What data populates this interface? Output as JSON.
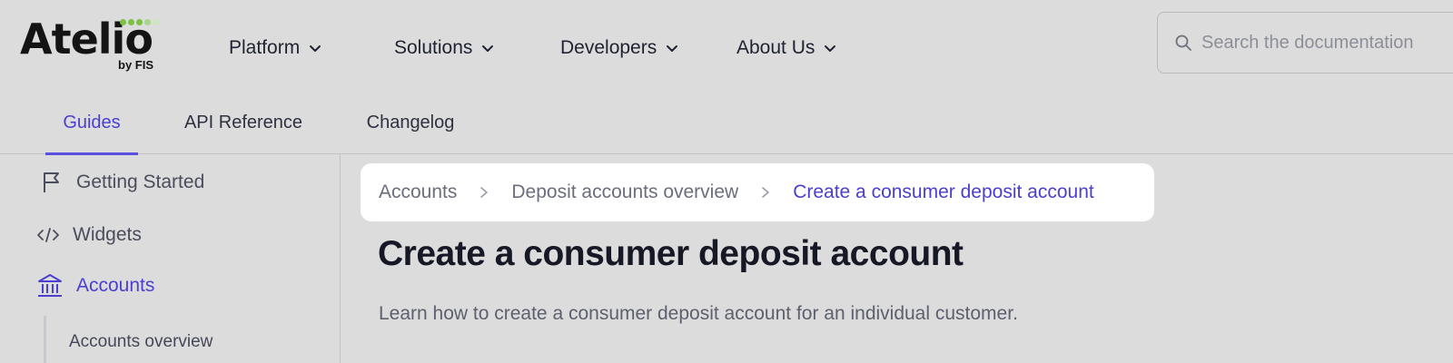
{
  "logo": {
    "wordmark": "Atelio",
    "sub": "by FIS",
    "dot_colors": [
      "#7bc142",
      "#7bc142",
      "#7bc142",
      "#a9d58a",
      "#cfe6bd"
    ]
  },
  "top_nav": {
    "items": [
      {
        "label": "Platform"
      },
      {
        "label": "Solutions"
      },
      {
        "label": "Developers"
      },
      {
        "label": "About Us"
      }
    ]
  },
  "search": {
    "placeholder": "Search the documentation",
    "icon": "search-icon"
  },
  "tabs": [
    {
      "label": "Guides",
      "active": true
    },
    {
      "label": "API Reference",
      "active": false
    },
    {
      "label": "Changelog",
      "active": false
    }
  ],
  "sidebar": {
    "items": [
      {
        "label": "Getting Started",
        "icon": "flag-icon"
      },
      {
        "label": "Widgets",
        "icon": "code-icon"
      },
      {
        "label": "Accounts",
        "icon": "bank-icon",
        "active": true
      }
    ],
    "sub_items": [
      {
        "label": "Accounts overview"
      }
    ]
  },
  "breadcrumb": {
    "items": [
      {
        "label": "Accounts"
      },
      {
        "label": "Deposit accounts overview"
      },
      {
        "label": "Create a consumer deposit account",
        "current": true
      }
    ]
  },
  "page": {
    "title": "Create a consumer deposit account",
    "description": "Learn how to create a consumer deposit account for an individual customer."
  },
  "colors": {
    "accent": "#4a3fcf",
    "background": "#dcdcdc",
    "card": "#ffffff"
  }
}
